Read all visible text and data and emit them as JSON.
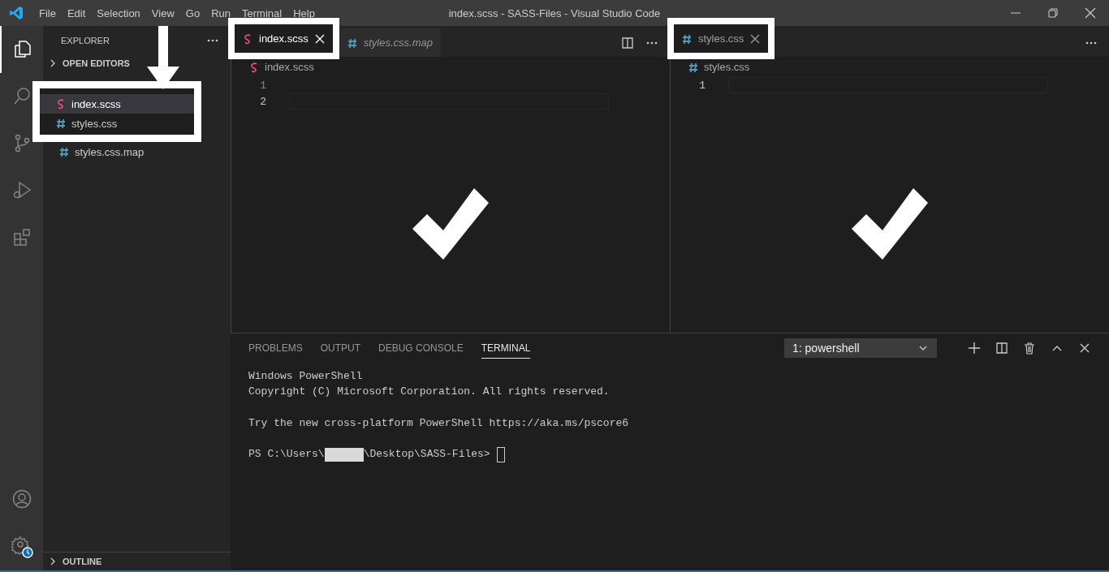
{
  "window": {
    "title": "index.scss - SASS-Files - Visual Studio Code"
  },
  "menu": [
    "File",
    "Edit",
    "Selection",
    "View",
    "Go",
    "Run",
    "Terminal",
    "Help"
  ],
  "activity_bar": [
    {
      "kind": "files",
      "selected": true
    },
    {
      "kind": "search",
      "selected": false
    },
    {
      "kind": "source-control",
      "selected": false
    },
    {
      "kind": "run",
      "selected": false
    },
    {
      "kind": "extensions",
      "selected": false
    }
  ],
  "activity_bar_bottom": [
    {
      "kind": "account"
    },
    {
      "kind": "settings"
    }
  ],
  "sidebar": {
    "title": "EXPLORER",
    "sections": [
      {
        "label": "OPEN EDITORS",
        "expanded": false
      }
    ],
    "files": [
      {
        "name": "index.scss",
        "kind": "scss",
        "selected": true,
        "highlighted": true
      },
      {
        "name": "styles.css",
        "kind": "css",
        "selected": false,
        "highlighted": true
      },
      {
        "name": "styles.css.map",
        "kind": "css",
        "selected": false,
        "highlighted": false
      }
    ],
    "outline": {
      "label": "OUTLINE",
      "expanded": false
    }
  },
  "editor_groups": [
    {
      "focused": true,
      "checkmark": true,
      "actions": [
        {
          "kind": "split"
        },
        {
          "kind": "more"
        }
      ],
      "tabs": [
        {
          "name": "index.scss",
          "kind": "scss",
          "selected": true,
          "preview": false,
          "highlighted": true
        },
        {
          "name": "styles.css.map",
          "kind": "css",
          "selected": false,
          "preview": true,
          "highlighted": false
        }
      ],
      "breadcrumb": {
        "name": "index.scss",
        "kind": "scss"
      },
      "lines": [
        {
          "number": "1",
          "active": false
        },
        {
          "number": "2",
          "active": true
        }
      ]
    },
    {
      "focused": false,
      "checkmark": true,
      "actions": [
        {
          "kind": "more"
        }
      ],
      "tabs": [
        {
          "name": "styles.css",
          "kind": "css",
          "selected": true,
          "preview": false,
          "highlighted": true
        }
      ],
      "breadcrumb": {
        "name": "styles.css",
        "kind": "css"
      },
      "lines": [
        {
          "number": "1",
          "active": true
        }
      ]
    }
  ],
  "panel": {
    "tabs": [
      {
        "label": "PROBLEMS",
        "selected": false
      },
      {
        "label": "OUTPUT",
        "selected": false
      },
      {
        "label": "DEBUG CONSOLE",
        "selected": false
      },
      {
        "label": "TERMINAL",
        "selected": true
      }
    ],
    "terminal_selector": "1: powershell",
    "actions": [
      {
        "kind": "new"
      },
      {
        "kind": "split"
      },
      {
        "kind": "trash"
      },
      {
        "kind": "maximize"
      },
      {
        "kind": "close"
      }
    ],
    "terminal_blocks": [
      [
        "Windows PowerShell",
        "Copyright (C) Microsoft Corporation. All rights reserved."
      ],
      [
        "Try the new cross-platform PowerShell https://aka.ms/pscore6"
      ]
    ],
    "prompt": {
      "start": "PS C:\\Users\\",
      "redacted": true,
      "end": "\\Desktop\\SASS-Files>",
      "cursor": true
    }
  }
}
